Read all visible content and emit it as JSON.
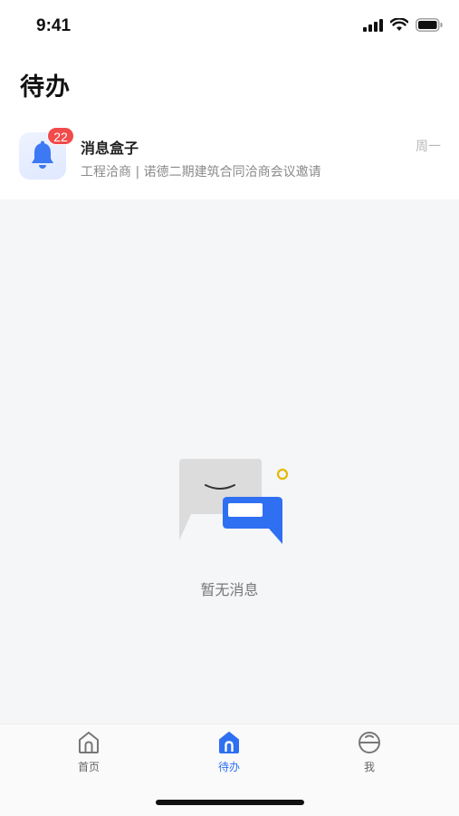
{
  "status_bar": {
    "time": "9:41"
  },
  "header": {
    "title": "待办"
  },
  "message": {
    "badge": "22",
    "title": "消息盒子",
    "subtitle": "工程洽商 | 诺德二期建筑合同洽商会议邀请",
    "day": "周一",
    "icon": "bell-icon"
  },
  "empty": {
    "text": "暂无消息",
    "icon": "chat-bubbles-icon"
  },
  "tabs": [
    {
      "label": "首页",
      "icon": "home-icon",
      "active": false
    },
    {
      "label": "待办",
      "icon": "todo-icon",
      "active": true
    },
    {
      "label": "我",
      "icon": "profile-icon",
      "active": false
    }
  ],
  "colors": {
    "accent": "#2f6ff2",
    "badge": "#f14b4b",
    "background": "#f5f6f8"
  }
}
